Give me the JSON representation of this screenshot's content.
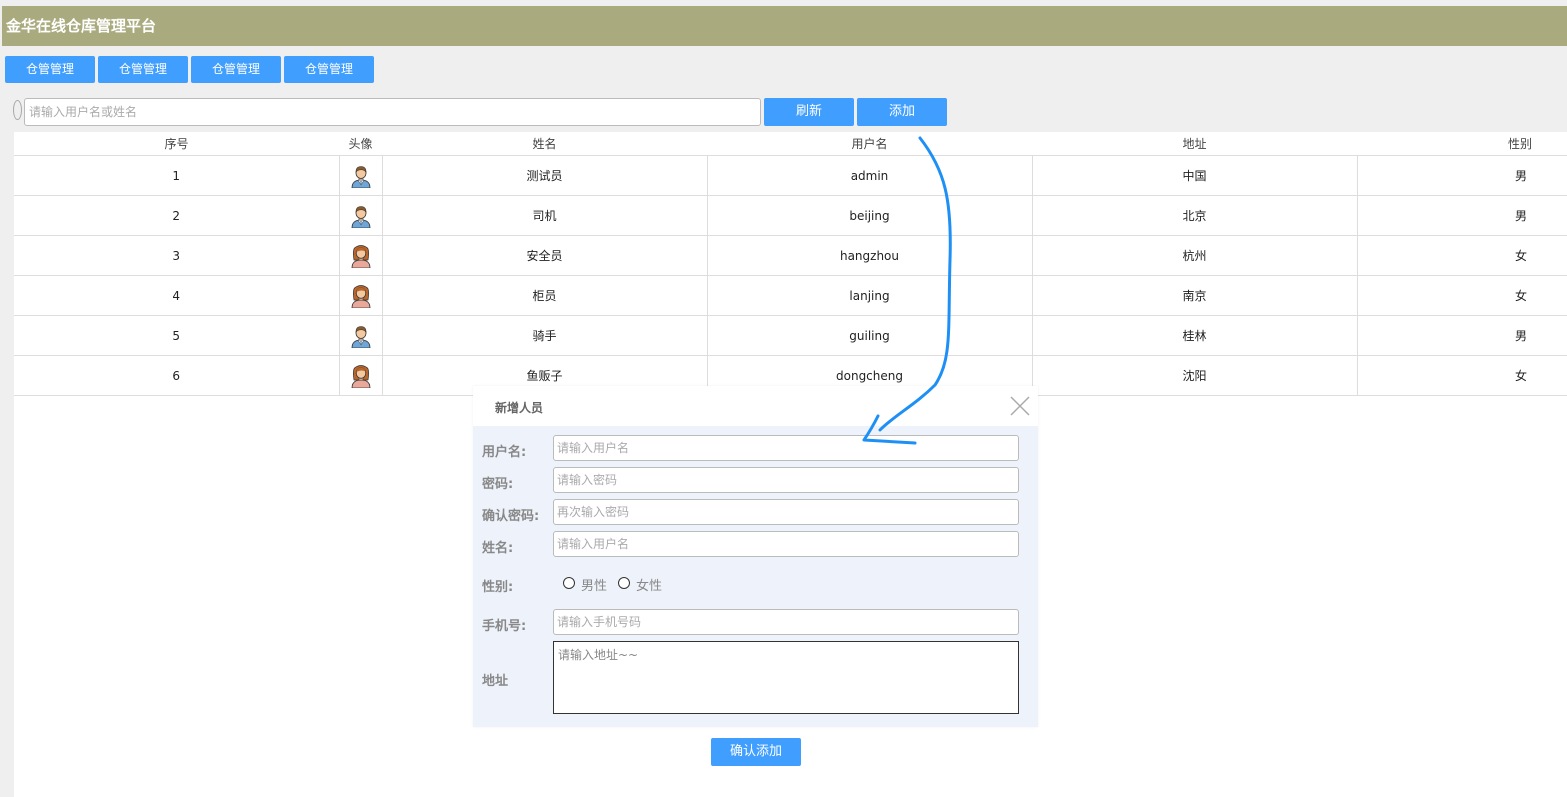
{
  "header": {
    "title": "金华在线仓库管理平台"
  },
  "nav": [
    "仓管管理",
    "仓管管理",
    "仓管管理",
    "仓管管理"
  ],
  "search": {
    "placeholder": "请输入用户名或姓名",
    "value": ""
  },
  "toolbar": {
    "refresh_label": "刷新",
    "add_label": "添加"
  },
  "table": {
    "columns": [
      "序号",
      "头像",
      "姓名",
      "用户名",
      "地址",
      "性别"
    ],
    "rows": [
      {
        "id": "1",
        "avatar": "male-avatar-icon",
        "name": "测试员",
        "username": "admin",
        "address": "中国",
        "gender": "男"
      },
      {
        "id": "2",
        "avatar": "male-avatar-icon",
        "name": "司机",
        "username": "beijing",
        "address": "北京",
        "gender": "男"
      },
      {
        "id": "3",
        "avatar": "female-avatar-icon",
        "name": "安全员",
        "username": "hangzhou",
        "address": "杭州",
        "gender": "女"
      },
      {
        "id": "4",
        "avatar": "female-avatar-icon",
        "name": "柜员",
        "username": "lanjing",
        "address": "南京",
        "gender": "女"
      },
      {
        "id": "5",
        "avatar": "male-avatar-icon",
        "name": "骑手",
        "username": "guiling",
        "address": "桂林",
        "gender": "男"
      },
      {
        "id": "6",
        "avatar": "female-avatar-icon",
        "name": "鱼贩子",
        "username": "dongcheng",
        "address": "沈阳",
        "gender": "女"
      }
    ]
  },
  "dialog": {
    "title": "新增人员",
    "close_icon": "close-icon",
    "fields": {
      "username": {
        "label": "用户名:",
        "placeholder": "请输入用户名"
      },
      "password": {
        "label": "密码:",
        "placeholder": "请输入密码"
      },
      "confirm": {
        "label": "确认密码:",
        "placeholder": "再次输入密码"
      },
      "name": {
        "label": "姓名:",
        "placeholder": "请输入用户名"
      },
      "gender": {
        "label": "性别:",
        "options": [
          "男性",
          "女性"
        ]
      },
      "phone": {
        "label": "手机号:",
        "placeholder": "请输入手机号码"
      },
      "address": {
        "label": "地址",
        "placeholder": "请输入地址~~"
      }
    },
    "submit_label": "确认添加"
  },
  "annotation": {
    "icon": "hand-drawn-arrow",
    "color": "#1e90f5"
  },
  "colors": {
    "header": "#a9aa7e",
    "primary": "#409eff",
    "dialog_bg": "#eef3fb"
  }
}
